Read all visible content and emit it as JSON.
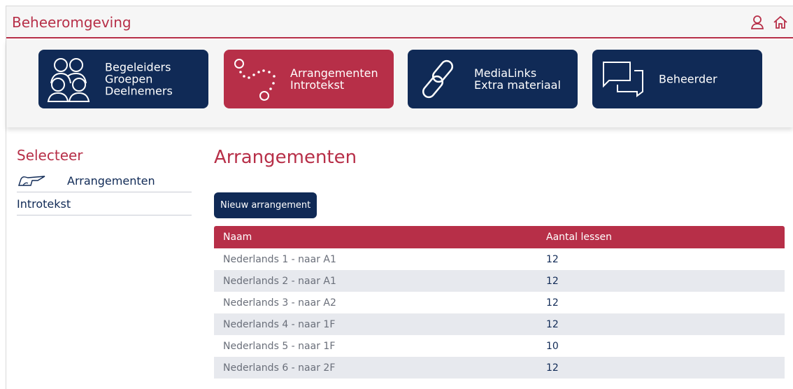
{
  "header": {
    "title": "Beheeromgeving",
    "icons": [
      "user-icon",
      "home-icon"
    ]
  },
  "tiles": [
    {
      "icon": "group-icon",
      "lines": [
        "Begeleiders",
        "Groepen",
        "Deelnemers"
      ],
      "active": false
    },
    {
      "icon": "path-dots-icon",
      "lines": [
        "Arrangementen",
        "Introtekst"
      ],
      "active": true
    },
    {
      "icon": "link-icon",
      "lines": [
        "MediaLinks",
        "Extra materiaal"
      ],
      "active": false
    },
    {
      "icon": "chat-icon",
      "lines": [
        "Beheerder"
      ],
      "active": false
    }
  ],
  "sidebar": {
    "title": "Selecteer",
    "items": [
      {
        "label": "Arrangementen",
        "icon": "pointing-hand-icon"
      },
      {
        "label": "Introtekst"
      }
    ]
  },
  "main": {
    "title": "Arrangementen",
    "new_button": "Nieuw arrangement",
    "table": {
      "columns": [
        "Naam",
        "Aantal lessen"
      ],
      "rows": [
        {
          "name": "Nederlands 1 - naar A1",
          "count": "12"
        },
        {
          "name": "Nederlands 2 - naar A1",
          "count": "12"
        },
        {
          "name": "Nederlands 3 - naar A2",
          "count": "12"
        },
        {
          "name": "Nederlands 4 - naar 1F",
          "count": "12"
        },
        {
          "name": "Nederlands 5 - naar 1F",
          "count": "10"
        },
        {
          "name": "Nederlands 6 - naar 2F",
          "count": "12"
        }
      ]
    }
  },
  "colors": {
    "accent": "#b72f48",
    "navy": "#102a56",
    "row_alt": "#e7e9ee"
  }
}
